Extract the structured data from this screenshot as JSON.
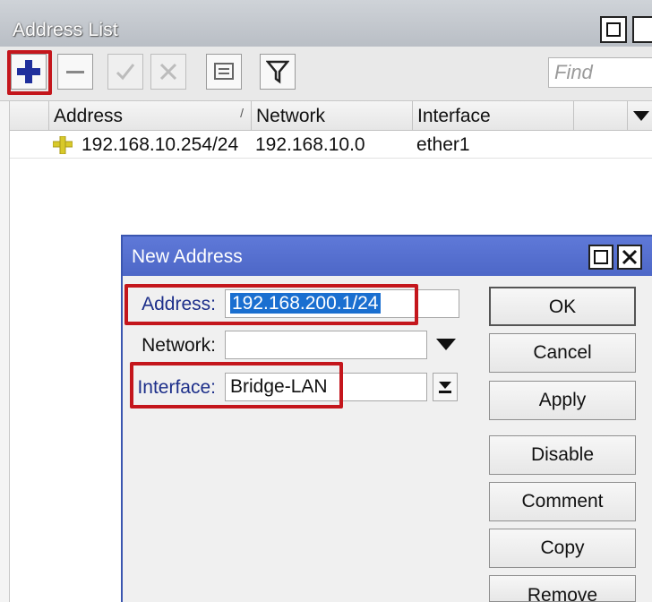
{
  "window": {
    "title": "Address List"
  },
  "toolbar": {
    "add_icon": "plus-icon",
    "remove_icon": "minus-icon",
    "enable_icon": "check-icon",
    "disable_icon": "x-icon",
    "comment_icon": "note-icon",
    "filter_icon": "filter-icon",
    "find_placeholder": "Find"
  },
  "table": {
    "columns": [
      "Address",
      "Network",
      "Interface"
    ],
    "rows": [
      {
        "address": "192.168.10.254/24",
        "network": "192.168.10.0",
        "interface": "ether1"
      }
    ]
  },
  "dialog": {
    "title": "New Address",
    "labels": {
      "address": "Address:",
      "network": "Network:",
      "interface": "Interface:"
    },
    "values": {
      "address": "192.168.200.1/24",
      "network": "",
      "interface": "Bridge-LAN"
    },
    "buttons": [
      "OK",
      "Cancel",
      "Apply",
      "Disable",
      "Comment",
      "Copy",
      "Remove"
    ]
  },
  "colors": {
    "highlight": "#c4161c",
    "dialog_title": "#4d67c7",
    "selection": "#1a6fd0"
  }
}
